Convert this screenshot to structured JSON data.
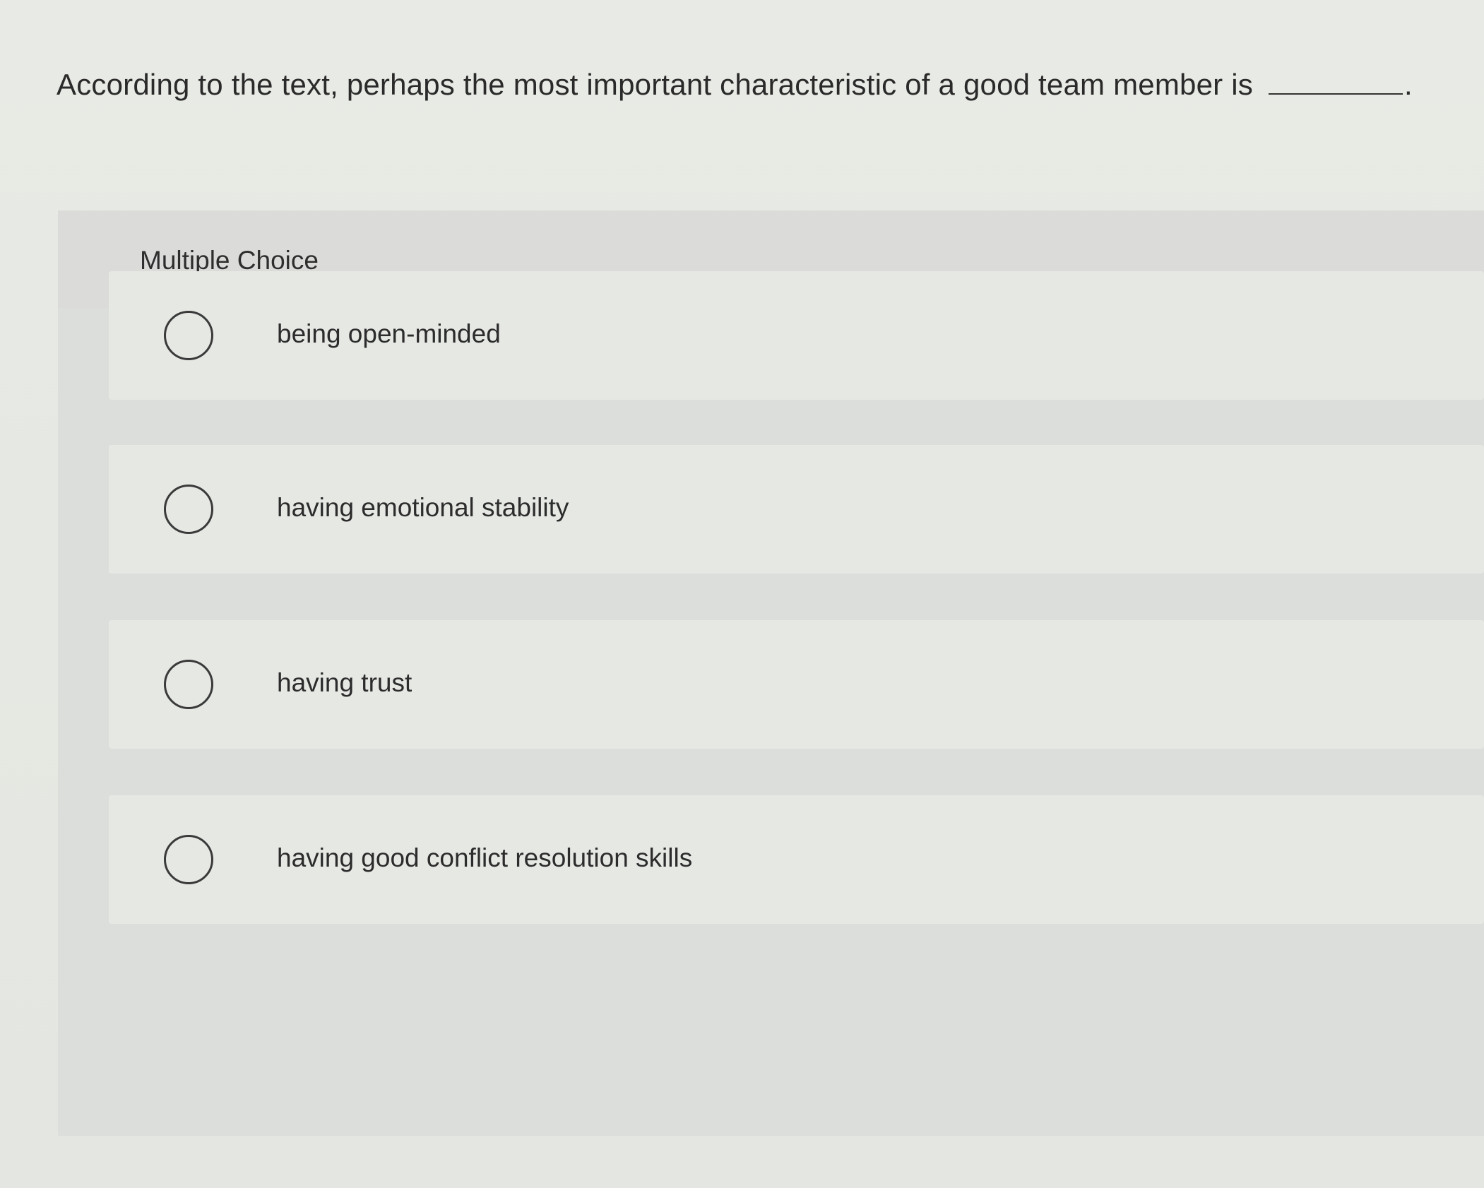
{
  "question": {
    "text": "According to the text, perhaps the most important characteristic of a good team member is",
    "period": "."
  },
  "multiple_choice": {
    "label": "Multiple Choice",
    "options": [
      {
        "label": "being open-minded"
      },
      {
        "label": "having emotional stability"
      },
      {
        "label": "having trust"
      },
      {
        "label": "having good conflict resolution skills"
      }
    ]
  }
}
